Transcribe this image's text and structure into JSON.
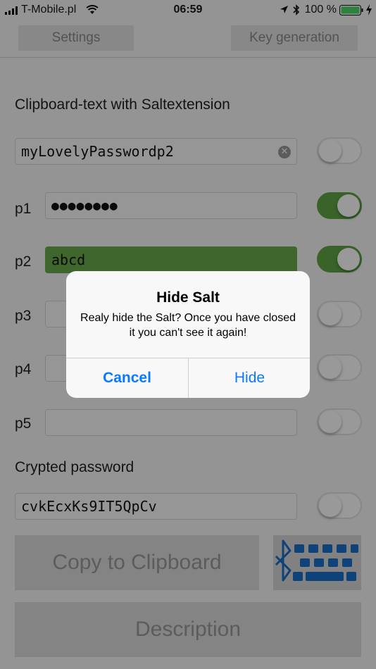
{
  "status_bar": {
    "carrier": "T-Mobile.pl",
    "time": "06:59",
    "battery_percent": "100 %"
  },
  "tabs": {
    "settings": "Settings",
    "key_generation": "Key generation"
  },
  "form": {
    "clipboard_label": "Clipboard-text with Saltextension",
    "clipboard_value": "myLovelyPasswordp2",
    "clear_symbol": "✕",
    "p1_label": "p1",
    "p1_value": "●●●●●●●●",
    "p2_label": "p2",
    "p2_value": "abcd",
    "p3_label": "p3",
    "p4_label": "p4",
    "p5_label": "p5",
    "crypted_label": "Crypted password",
    "crypted_value": "cvkEcxKs9IT5QpCv",
    "toggles": {
      "clipboard": false,
      "p1": true,
      "p2": true,
      "p3": false,
      "p4": false,
      "p5": false,
      "crypted": false
    }
  },
  "buttons": {
    "copy": "Copy to Clipboard",
    "description": "Description"
  },
  "alert": {
    "title": "Hide Salt",
    "message": "Realy hide the Salt? Once you have closed it you can't see it again!",
    "cancel": "Cancel",
    "confirm": "Hide"
  },
  "colors": {
    "accent_green": "#5fa544",
    "ios_blue": "#0a7aff",
    "bluetooth_blue": "#1a6fc8"
  },
  "icons": [
    "signal-bars-icon",
    "wifi-icon",
    "location-arrow-icon",
    "bluetooth-icon",
    "battery-icon",
    "charging-bolt-icon",
    "clear-icon",
    "bluetooth-keyboard-icon"
  ]
}
